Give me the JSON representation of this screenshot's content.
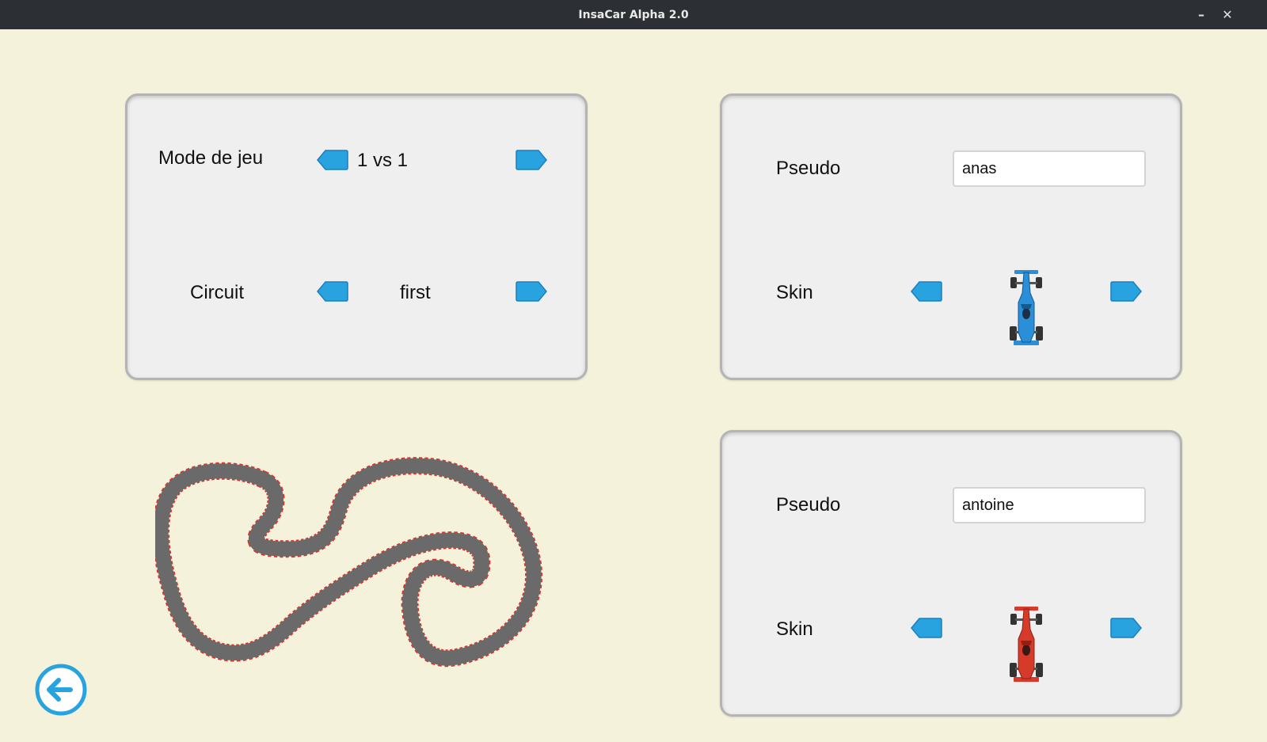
{
  "window": {
    "title": "InsaCar Alpha 2.0",
    "minimize_symbol": "–",
    "close_symbol": "✕"
  },
  "game_settings": {
    "mode_label": "Mode de jeu",
    "mode_value": "1 vs 1",
    "circuit_label": "Circuit",
    "circuit_value": "first"
  },
  "player1": {
    "pseudo_label": "Pseudo",
    "pseudo_value": "anas",
    "skin_label": "Skin",
    "car_color": "#2a8fd6"
  },
  "player2": {
    "pseudo_label": "Pseudo",
    "pseudo_value": "antoine",
    "skin_label": "Skin",
    "car_color": "#d63a2a"
  },
  "colors": {
    "background": "#f5f2dc",
    "accent_blue": "#29a3e0",
    "track_gray": "#6a6a6a",
    "track_edge": "#e0302a"
  },
  "icons": {
    "prev": "arrow-left-icon",
    "next": "arrow-right-icon",
    "back": "back-arrow-circle-icon"
  }
}
